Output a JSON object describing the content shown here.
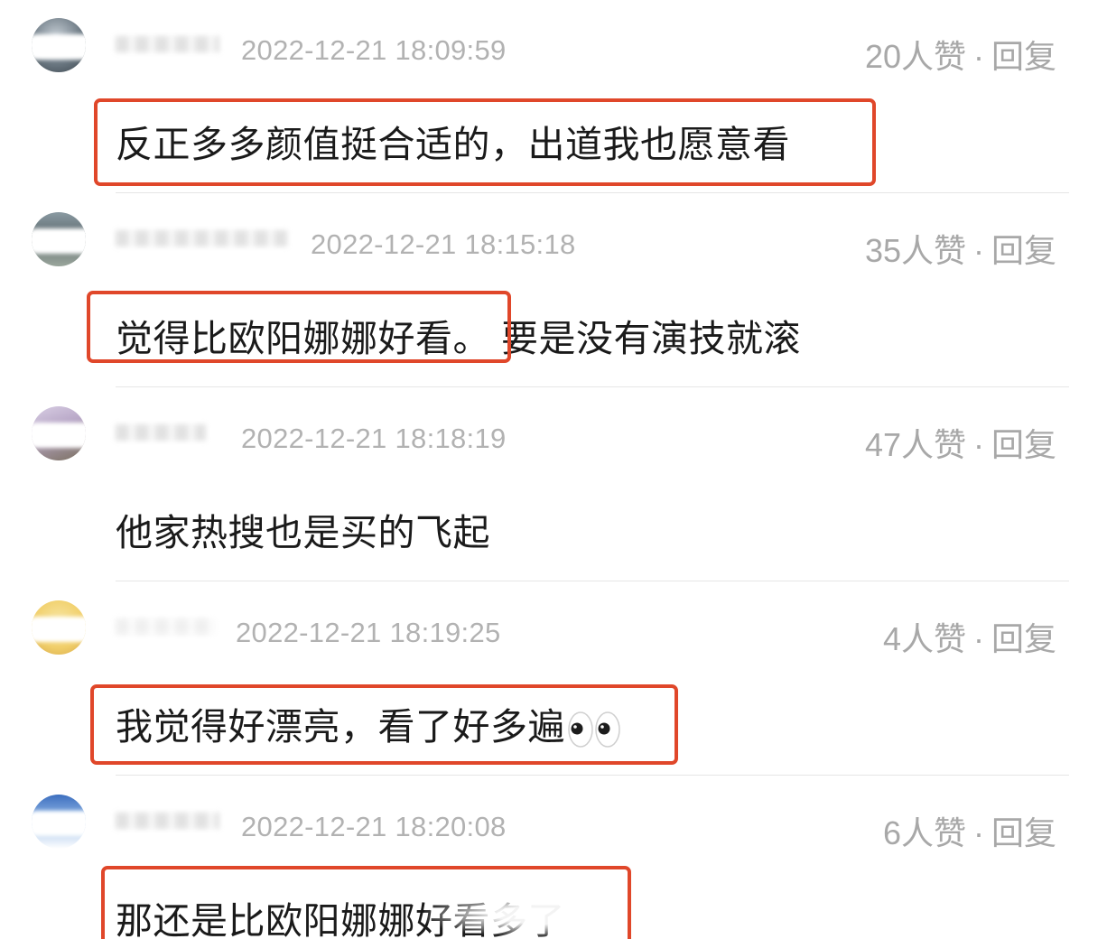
{
  "comments": [
    {
      "timestamp": "2022-12-21 18:09:59",
      "likes": "20人赞",
      "separator": "·",
      "reply": "回复",
      "content": "反正多多颜值挺合适的，出道我也愿意看",
      "content_rest": ""
    },
    {
      "timestamp": "2022-12-21 18:15:18",
      "likes": "35人赞",
      "separator": "·",
      "reply": "回复",
      "content": "觉得比欧阳娜娜好看。",
      "content_rest": "要是没有演技就滚"
    },
    {
      "timestamp": "2022-12-21 18:18:19",
      "likes": "47人赞",
      "separator": "·",
      "reply": "回复",
      "content": "他家热搜也是买的飞起",
      "content_rest": ""
    },
    {
      "timestamp": "2022-12-21 18:19:25",
      "likes": "4人赞",
      "separator": "·",
      "reply": "回复",
      "content": "我觉得好漂亮，看了好多遍",
      "content_rest": ""
    },
    {
      "timestamp": "2022-12-21 18:20:08",
      "likes": "6人赞",
      "separator": "·",
      "reply": "回复",
      "content": "那还是比欧阳娜娜好看多了",
      "content_rest": ""
    }
  ],
  "highlight_color": "#e0472a",
  "emoji": "eyes-emoji"
}
